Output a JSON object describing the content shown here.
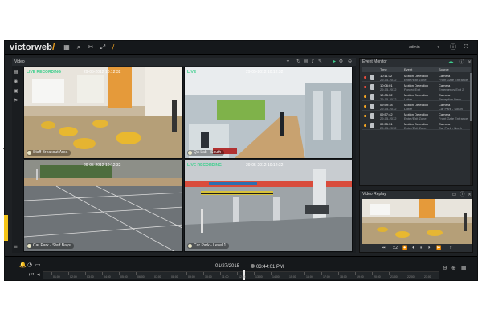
{
  "app": {
    "logo_main": "victorweb",
    "logo_accent": "/",
    "user": "admin",
    "topbar_icons": [
      "grid-icon",
      "search-icon",
      "tools-icon",
      "expand-icon",
      "edit-icon"
    ],
    "right_icons": [
      "info-icon",
      "fullscreen-icon"
    ]
  },
  "video": {
    "title": "Video",
    "cameras": [
      {
        "label": "Staff Breakout Area",
        "status": "LIVE RECORDING",
        "time": "29-05-2012 10:12:32"
      },
      {
        "label": "QA Lab - South",
        "status": "LIVE",
        "time": "29-05-2012 10:12:32"
      },
      {
        "label": "Car Park - Staff Bays",
        "status": "",
        "time": "29-05-2012 10:12:32"
      },
      {
        "label": "Car Park - Level 1",
        "status": "LIVE RECORDING",
        "time": "29-05-2012 10:12:32"
      }
    ]
  },
  "events": {
    "title": "Event Monitor",
    "headers": {
      "time": "Time",
      "event": "Event",
      "source": "Source"
    },
    "rows": [
      {
        "sev": "#e74c3c",
        "time": "10:11:32",
        "date": "29-05-2012",
        "event": "Motion Detection",
        "event2": "Enter/Exit Zone",
        "source": "Camera",
        "source2": "Front Gate Entrance"
      },
      {
        "sev": "#e74c3c",
        "time": "10:06:01",
        "date": "29-05-2012",
        "event": "Motion Detection",
        "event2": "Forced Exit",
        "source": "Camera",
        "source2": "Emergency Exit 2"
      },
      {
        "sev": "#f5a623",
        "time": "10:05:52",
        "date": "29-05-2012",
        "event": "Motion Detection",
        "event2": "Loiter",
        "source": "Camera",
        "source2": "Reception Desk"
      },
      {
        "sev": "#f5a623",
        "time": "09:59:18",
        "date": "29-05-2012",
        "event": "Motion Detection",
        "event2": "Loiter",
        "source": "Camera",
        "source2": "Car Park - South"
      },
      {
        "sev": "#f5a623",
        "time": "09:57:42",
        "date": "29-05-2012",
        "event": "Motion Detection",
        "event2": "Enter/Exit Zone",
        "source": "Camera",
        "source2": "Front Gate Entrance"
      },
      {
        "sev": "#f5a623",
        "time": "09:55:31",
        "date": "29-05-2012",
        "event": "Motion Detection",
        "event2": "Enter/Exit Zone",
        "source": "Camera",
        "source2": "Car Park - North"
      }
    ]
  },
  "replay": {
    "title": "Video Replay",
    "speed": "x2"
  },
  "timeline": {
    "date": "01/27/2015",
    "time": "03:44:01 PM",
    "labels": [
      "01:00",
      "02:00",
      "03:00",
      "04:00",
      "05:00",
      "06:00",
      "07:00",
      "08:00",
      "09:00",
      "10:00",
      "11:00",
      "12:00",
      "13:00",
      "14:00",
      "15:00",
      "16:00",
      "17:00",
      "18:00",
      "19:00",
      "20:00",
      "21:00",
      "22:00",
      "23:00"
    ]
  }
}
